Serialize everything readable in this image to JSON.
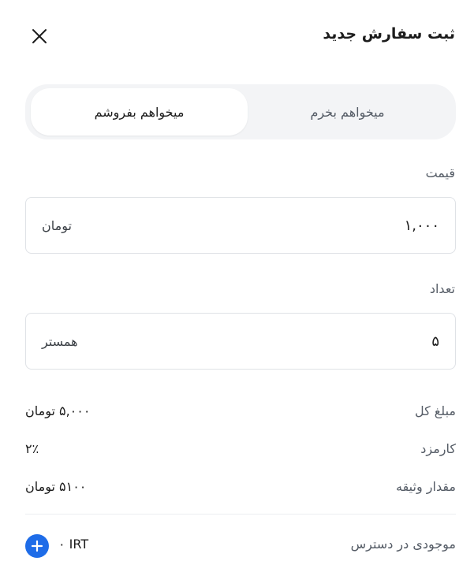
{
  "header": {
    "title": "ثبت سفارش جدید"
  },
  "tabs": {
    "buy_label": "میخواهم بخرم",
    "sell_label": "میخواهم بفروشم",
    "selected": "sell"
  },
  "price": {
    "label": "قیمت",
    "value": "۱,۰۰۰",
    "unit": "تومان"
  },
  "quantity": {
    "label": "تعداد",
    "value": "۵",
    "unit": "همستر"
  },
  "summary": {
    "total_label": "مبلغ کل",
    "total_value": "۵,۰۰۰ تومان",
    "fee_label": "کارمزد",
    "fee_value": "۲٪",
    "collateral_label": "مقدار وثیقه",
    "collateral_value": "۵۱۰۰ تومان"
  },
  "balance": {
    "label": "موجودی در دسترس",
    "value": "۰ IRT"
  },
  "colors": {
    "accent": "#1e6ce8",
    "border": "#dfe2e6",
    "segment_bg": "#f3f4f6"
  }
}
